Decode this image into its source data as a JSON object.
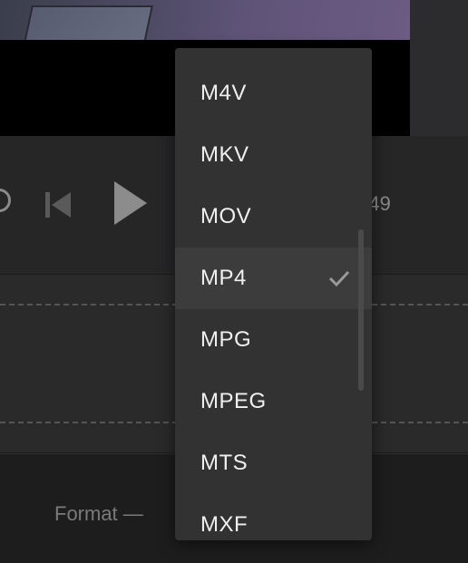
{
  "player": {
    "time_partial": "0:49"
  },
  "footer": {
    "format_label": "Format —"
  },
  "format_menu": {
    "items": [
      "M4V",
      "MKV",
      "MOV",
      "MP4",
      "MPG",
      "MPEG",
      "MTS",
      "MXF"
    ],
    "selected": "MP4"
  },
  "icons": {
    "loop": "loop-icon",
    "previous": "skip-previous-icon",
    "play": "play-icon",
    "check": "check-icon"
  },
  "colors": {
    "menu_background": "#323233",
    "menu_selected": "#3c3c3d",
    "menu_text": "#f0f0f0",
    "control_icon": "#888888"
  }
}
